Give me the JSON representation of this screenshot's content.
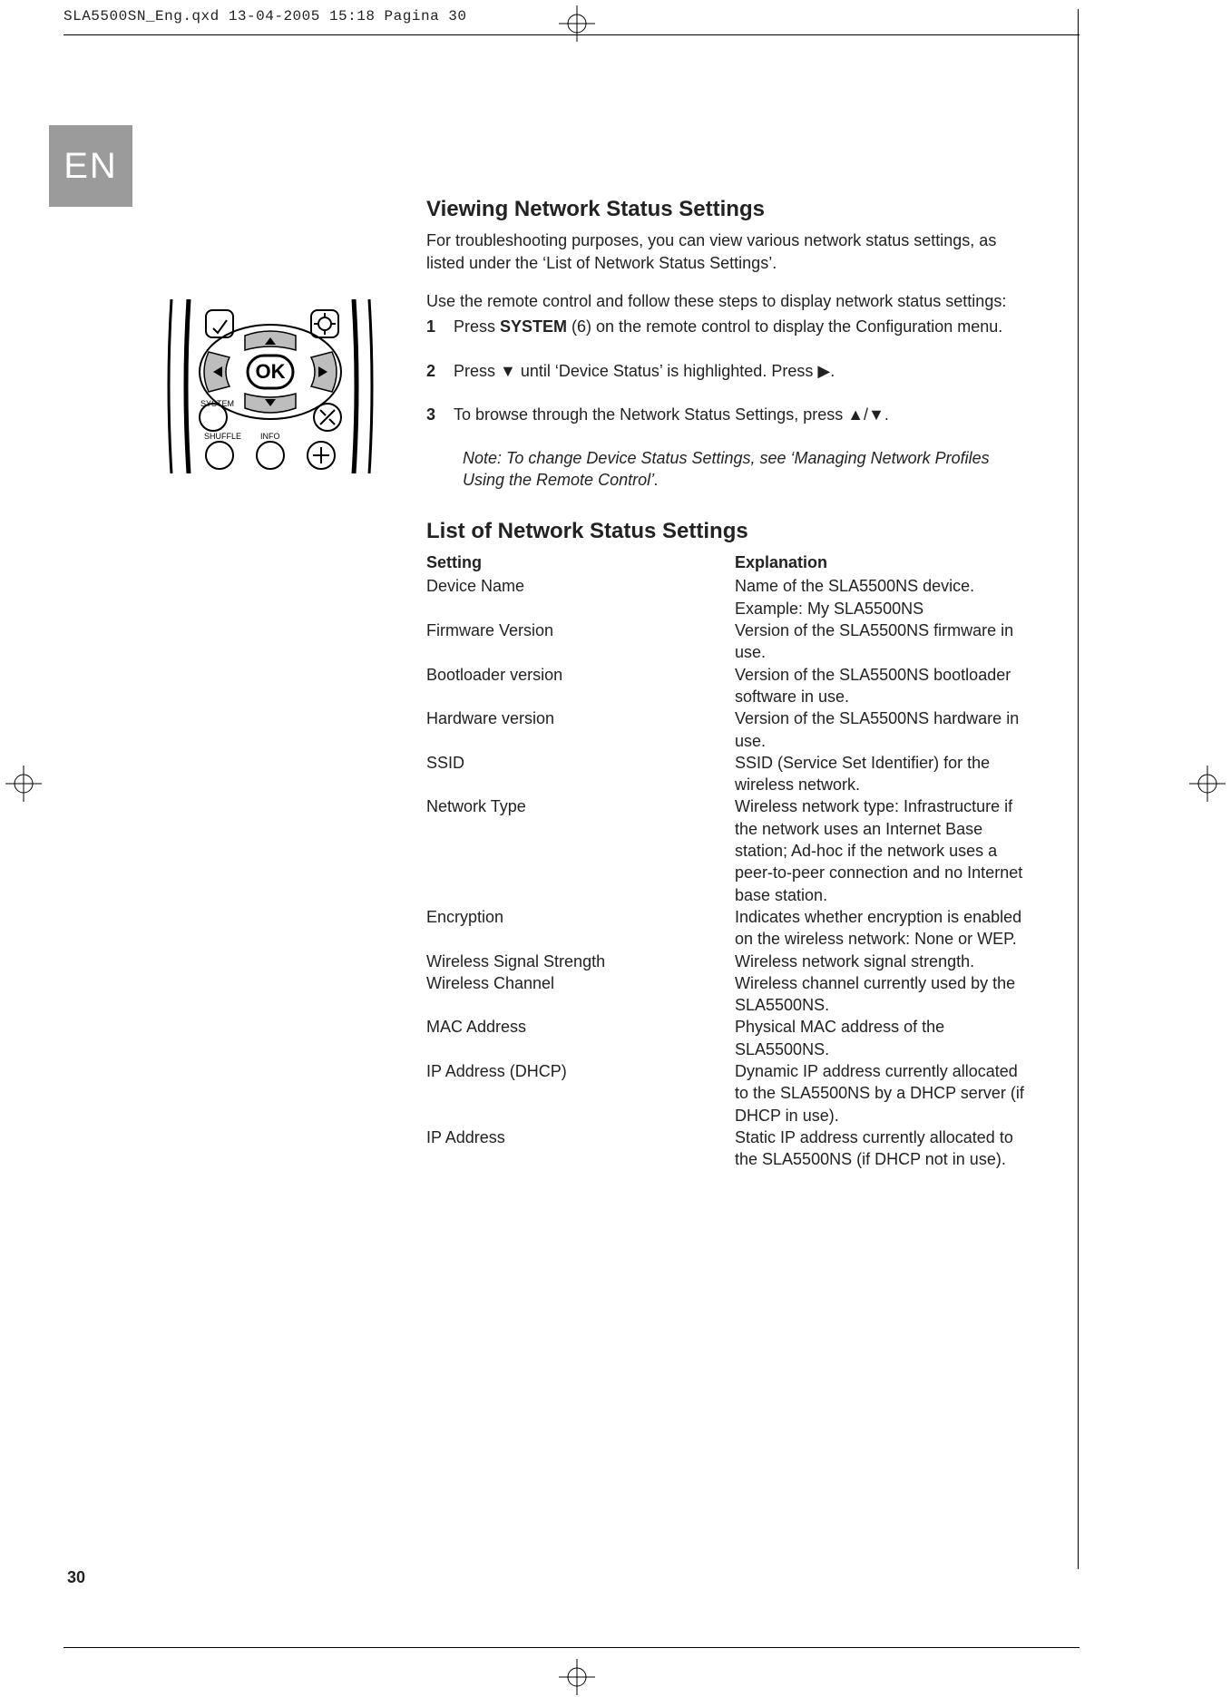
{
  "header": "SLA5500SN_Eng.qxd  13-04-2005  15:18  Pagina 30",
  "lang_tab": "EN",
  "section_title": "Viewing Network Status Settings",
  "intro": "For troubleshooting purposes, you can view various network status settings, as listed under the ‘List of Network Status Settings’.",
  "lead": "Use the remote control and follow these steps to display network status settings:",
  "steps": [
    {
      "num": "1",
      "pre": "Press ",
      "bold": "SYSTEM",
      "post": " (6) on the remote control to display the Configuration menu."
    },
    {
      "num": "2",
      "pre": "Press ",
      "glyph1": "▼",
      "mid": " until ‘Device Status’ is highlighted. Press ",
      "glyph2": "▶",
      "post": "."
    },
    {
      "num": "3",
      "pre": "To browse through the Network Status Settings, press ",
      "glyph1": "▲",
      "mid": "/",
      "glyph2": "▼",
      "post": "."
    }
  ],
  "note": "Note: To change Device Status Settings, see ‘Managing Network Profiles Using the Remote Control’.",
  "list_title": "List of Network Status Settings",
  "table_headers": {
    "setting": "Setting",
    "explanation": "Explanation"
  },
  "settings": [
    {
      "name": "Device Name",
      "desc": "Name of the SLA5500NS device. Example: My SLA5500NS"
    },
    {
      "name": "Firmware Version",
      "desc": "Version of the SLA5500NS firmware in use."
    },
    {
      "name": "Bootloader version",
      "desc": "Version of the SLA5500NS bootloader software in use."
    },
    {
      "name": "Hardware version",
      "desc": "Version of the SLA5500NS hardware in use."
    },
    {
      "name": "SSID",
      "desc": "SSID (Service Set Identifier) for the wireless network."
    },
    {
      "name": "Network Type",
      "desc": "Wireless network type: Infrastructure if the network uses an Internet Base station; Ad-hoc if the network uses a peer-to-peer connection and no Internet base station."
    },
    {
      "name": "Encryption",
      "desc": "Indicates whether encryption is enabled on the wireless network: None or WEP."
    },
    {
      "name": "Wireless Signal Strength",
      "desc": "Wireless network signal strength."
    },
    {
      "name": "Wireless Channel",
      "desc": "Wireless channel currently used by the SLA5500NS."
    },
    {
      "name": "MAC Address",
      "desc": "Physical MAC address of the SLA5500NS."
    },
    {
      "name": "IP Address (DHCP)",
      "desc": "Dynamic IP address currently allocated to the SLA5500NS by a DHCP server (if DHCP in use)."
    },
    {
      "name": "IP Address",
      "desc": "Static IP address currently allocated to the SLA5500NS (if DHCP not in use)."
    }
  ],
  "page_number": "30",
  "remote_labels": {
    "ok": "OK",
    "system": "SYSTEM",
    "shuffle": "SHUFFLE",
    "info": "INFO"
  }
}
